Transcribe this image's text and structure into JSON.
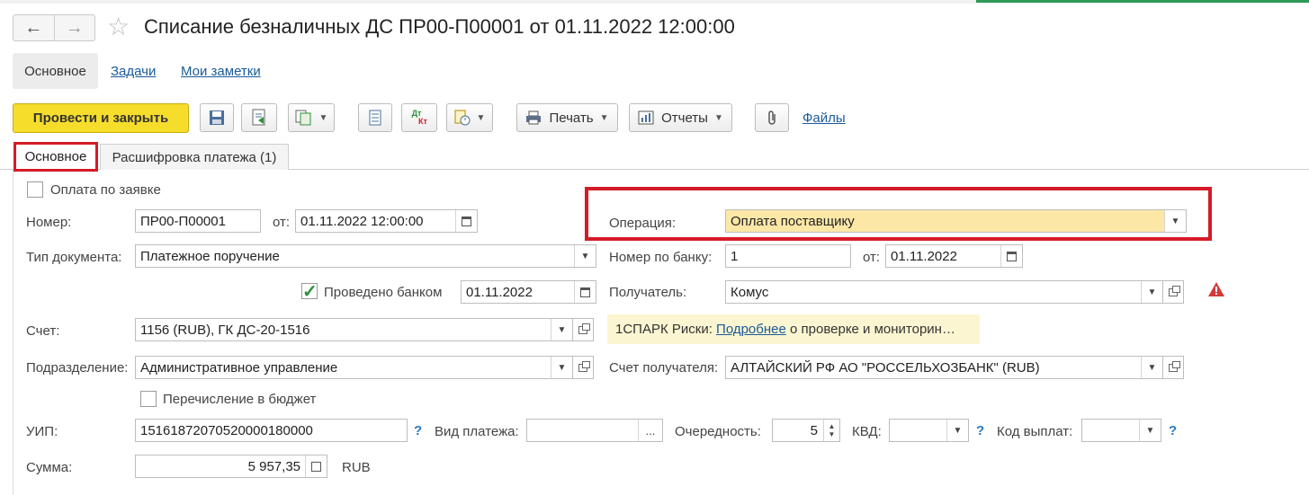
{
  "window": {
    "title": "Списание безналичных ДС ПР00-П00001 от 01.11.2022 12:00:00"
  },
  "nav": {
    "back": "←",
    "forward": "→",
    "favorite": "☆"
  },
  "form_tabs": [
    "Основное",
    "Задачи",
    "Мои заметки"
  ],
  "toolbar": {
    "post_close": "Провести и закрыть",
    "print": "Печать",
    "reports": "Отчеты",
    "files": "Файлы",
    "dt_kt_top": "Дт",
    "dt_kt_bottom": "Кт"
  },
  "page_tabs": [
    "Основное",
    "Расшифровка платежа (1)"
  ],
  "fields": {
    "by_request": "Оплата по заявке",
    "number_label": "Номер:",
    "number_value": "ПР00-П00001",
    "from_label": "от:",
    "date_value": "01.11.2022 12:00:00",
    "doc_type_label": "Тип документа:",
    "doc_type_value": "Платежное поручение",
    "bank_posted_label": "Проведено банком",
    "bank_posted_date": "01.11.2022",
    "account_label": "Счет:",
    "account_value": "1156 (RUB), ГК ДС-20-1516",
    "division_label": "Подразделение:",
    "division_value": "Административное управление",
    "budget_transfer": "Перечисление в бюджет",
    "uip_label": "УИП:",
    "uip_value": "15161872070520000180000",
    "payment_type_label": "Вид платежа:",
    "payment_type_value": "",
    "priority_label": "Очередность:",
    "priority_value": "5",
    "kvd_label": "КВД:",
    "kvd_value": "",
    "payout_code_label": "Код выплат:",
    "payout_code_value": "",
    "sum_label": "Сумма:",
    "sum_value": "5 957,35",
    "currency": "RUB",
    "operation_label": "Операция:",
    "operation_value": "Оплата поставщику",
    "bank_number_label": "Номер по банку:",
    "bank_number_value": "1",
    "bank_date_label": "от:",
    "bank_date_value": "01.11.2022",
    "recipient_label": "Получатель:",
    "recipient_value": "Комус",
    "recipient_account_label": "Счет получателя:",
    "recipient_account_value": "АЛТАЙСКИЙ РФ АО \"РОССЕЛЬХОЗБАНК\" (RUB)"
  },
  "spark": {
    "prefix": "1СПАРК Риски:",
    "link": "Подробнее",
    "suffix": "о проверке и мониторин…"
  },
  "help_mark": "?",
  "colors": {
    "accent_yellow": "#f6dd2b",
    "highlight_red": "#d51b27",
    "operation_bg": "#fde7a7",
    "link": "#1a5a99"
  }
}
